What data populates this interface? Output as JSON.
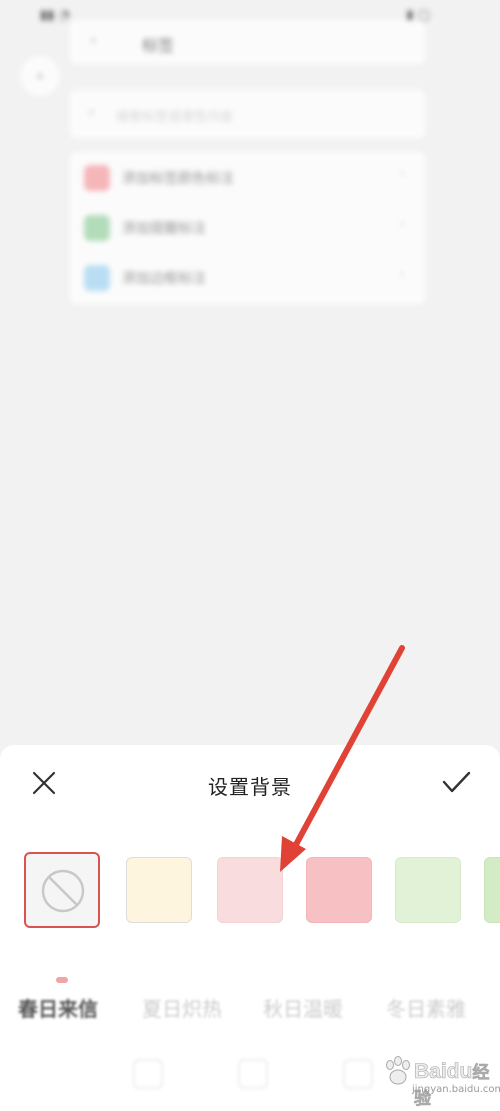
{
  "background_screen": {
    "header_title": "标签",
    "search_placeholder": "搜索标签或便签内容",
    "list_items": [
      {
        "label": "添加标签颜色标注",
        "color": "#f7a3a8"
      },
      {
        "label": "添加提醒标注",
        "color": "#9ed6a8"
      },
      {
        "label": "添加边框标注",
        "color": "#a7d8f5"
      }
    ]
  },
  "sheet": {
    "title": "设置背景",
    "close_icon": "close-icon",
    "confirm_icon": "check-icon",
    "swatches": [
      {
        "name": "none",
        "color": "#f5f5f5"
      },
      {
        "name": "cream",
        "color": "#fdf5de"
      },
      {
        "name": "light-pink",
        "color": "#f9dcdd"
      },
      {
        "name": "pink",
        "color": "#f7c1c3"
      },
      {
        "name": "light-green",
        "color": "#e1f2d6"
      },
      {
        "name": "green",
        "color": "#d3ecc6"
      }
    ],
    "tabs": [
      "春日来信",
      "夏日炽热",
      "秋日温暖",
      "冬日素雅"
    ]
  },
  "watermark": {
    "brand": "Baidu",
    "suffix": "经验",
    "domain": "jingyan.baidu.com"
  },
  "accent_color": "#e04236"
}
